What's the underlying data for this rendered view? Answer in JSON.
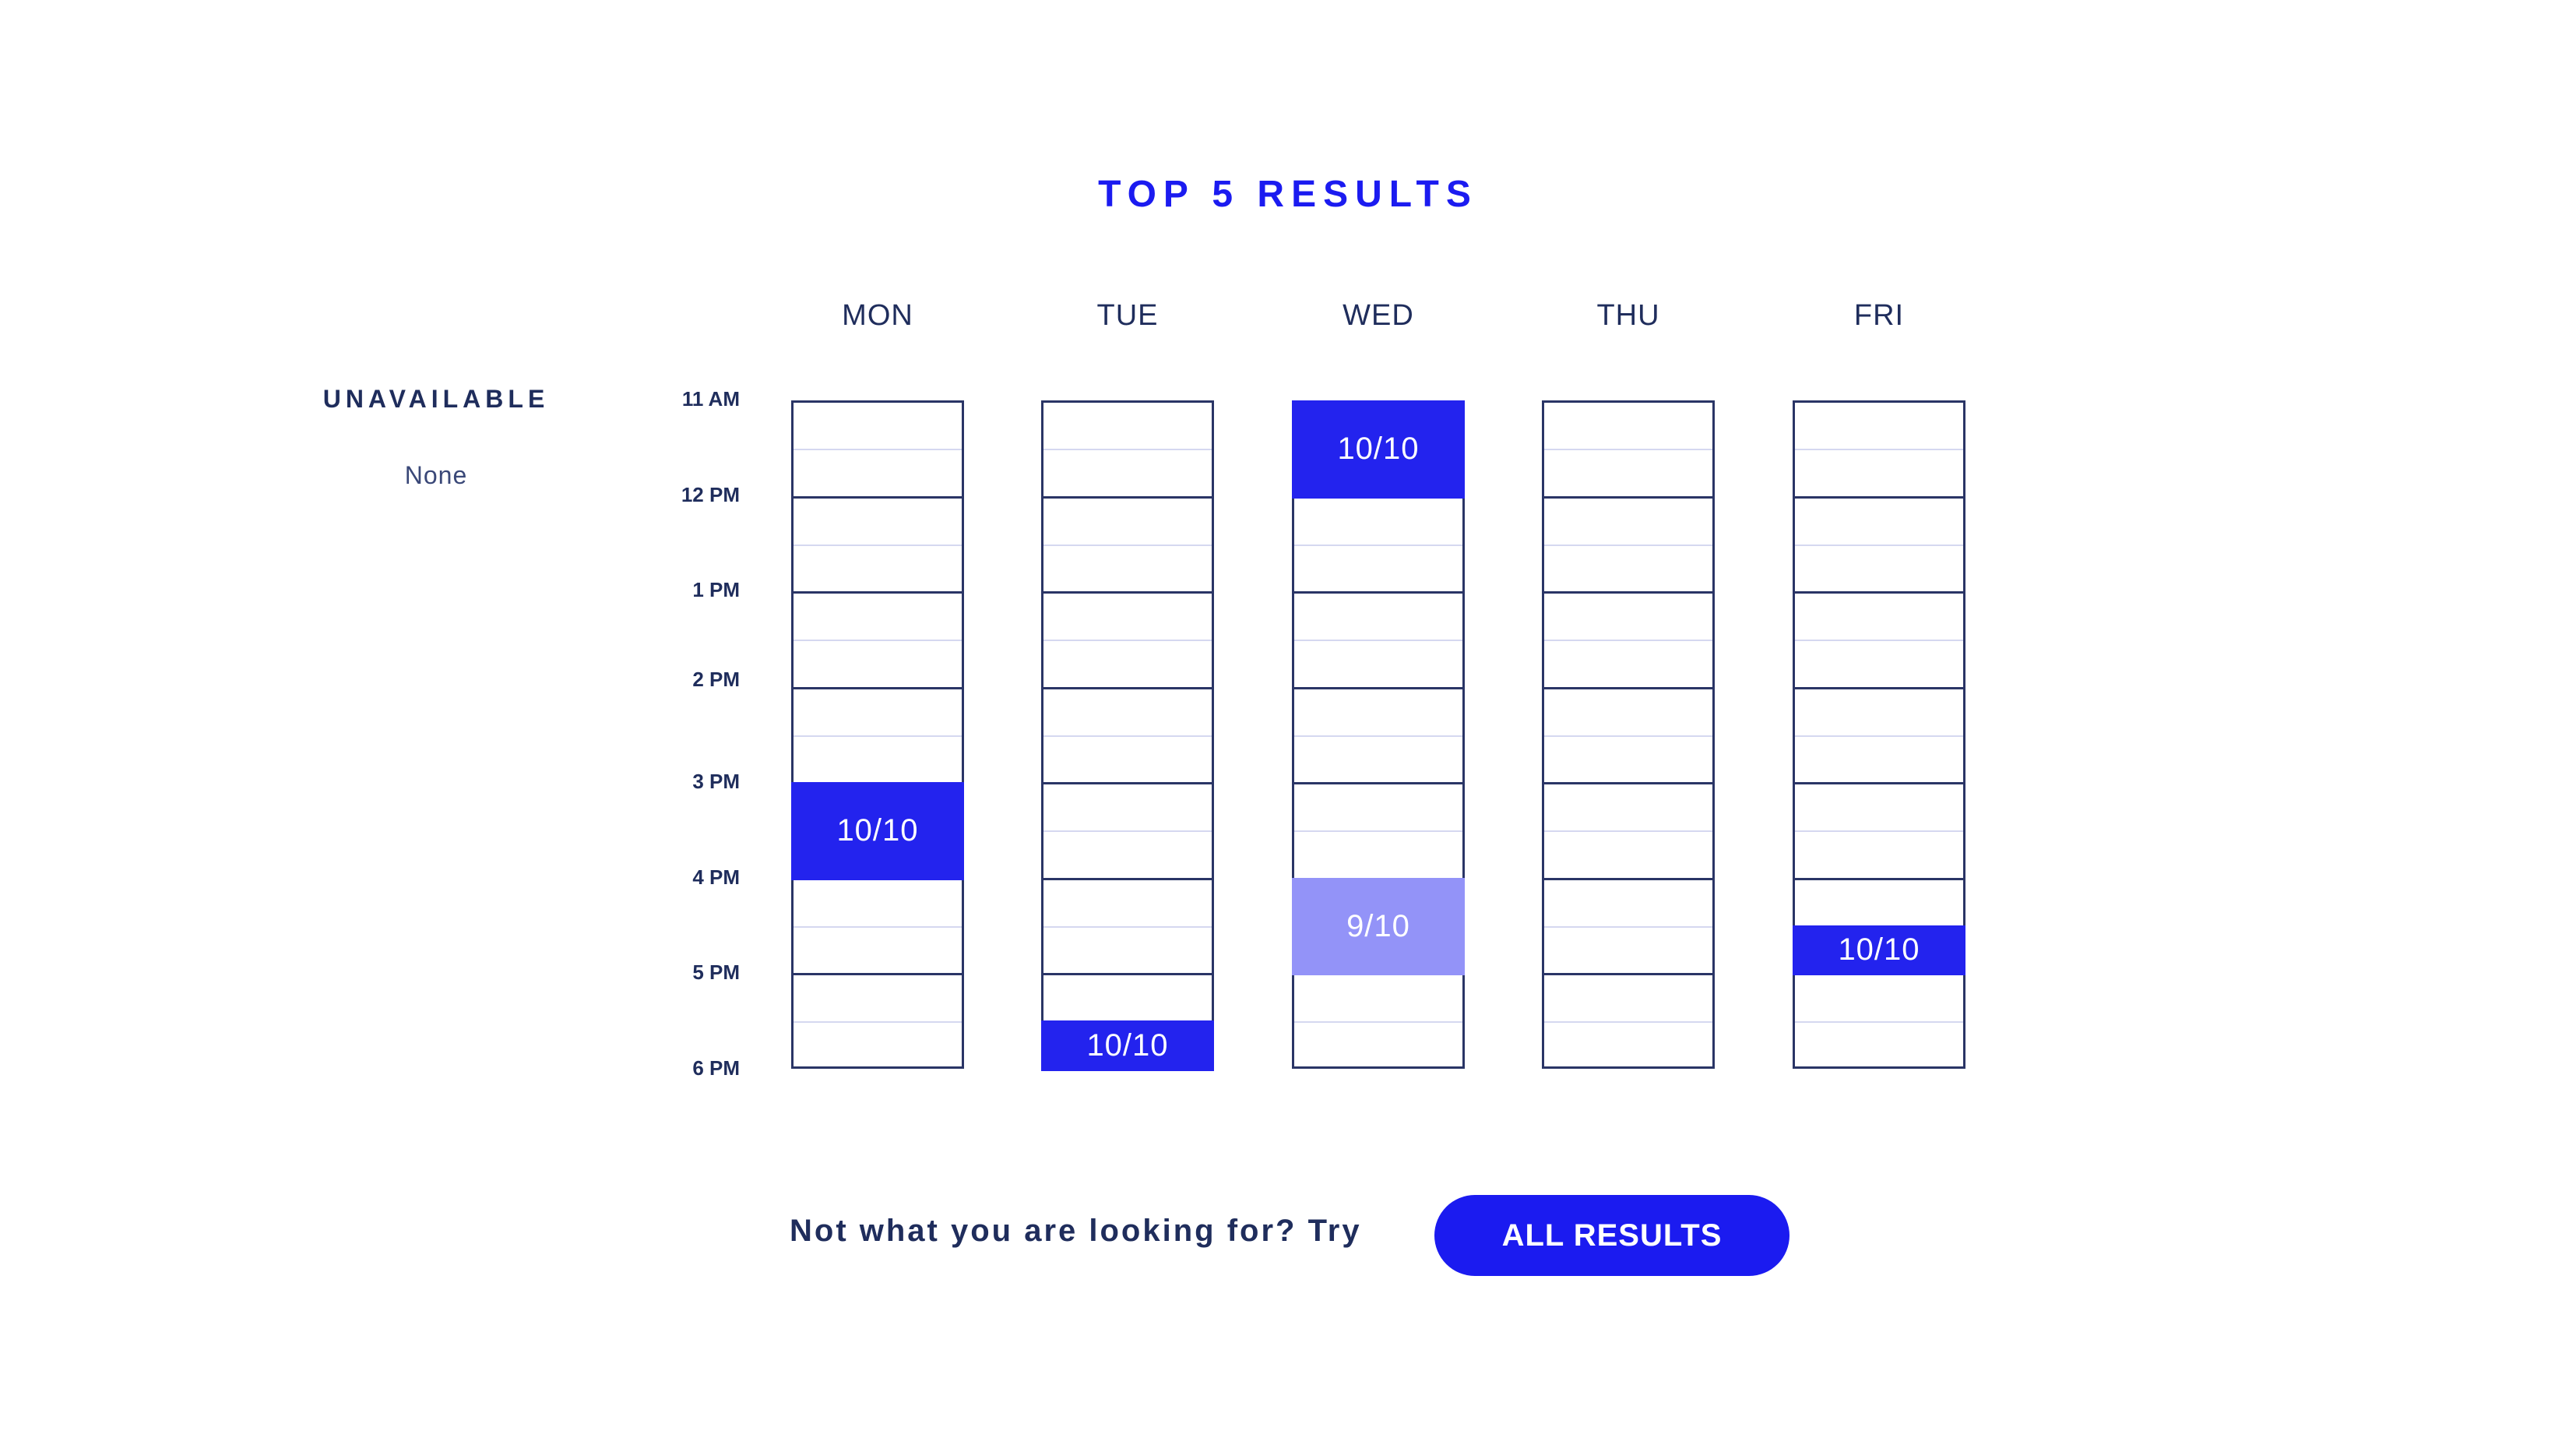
{
  "title": "TOP 5 RESULTS",
  "unavailable": {
    "label": "UNAVAILABLE",
    "value": "None"
  },
  "days": [
    "MON",
    "TUE",
    "WED",
    "THU",
    "FRI"
  ],
  "times": [
    "11 AM",
    "12 PM",
    "1 PM",
    "2 PM",
    "3 PM",
    "4 PM",
    "5 PM",
    "6 PM"
  ],
  "results": [
    {
      "day": "MON",
      "start": "3 PM",
      "end": "4 PM",
      "score": "10/10",
      "strength": "full"
    },
    {
      "day": "TUE",
      "start": "5:30 PM",
      "end": "6 PM",
      "score": "10/10",
      "strength": "full"
    },
    {
      "day": "WED",
      "start": "11 AM",
      "end": "12 PM",
      "score": "10/10",
      "strength": "full"
    },
    {
      "day": "WED",
      "start": "4 PM",
      "end": "5 PM",
      "score": "9/10",
      "strength": "partial"
    },
    {
      "day": "FRI",
      "start": "4:30 PM",
      "end": "5 PM",
      "score": "10/10",
      "strength": "full"
    }
  ],
  "footer": {
    "prompt": "Not what you are looking for? Try",
    "button_label": "ALL RESULTS"
  },
  "colors": {
    "accent": "#1b1bf0",
    "block_full": "#2323ee",
    "block_partial": "#9393f8",
    "grid_line": "#2a3566",
    "text": "#1f2d5c"
  }
}
